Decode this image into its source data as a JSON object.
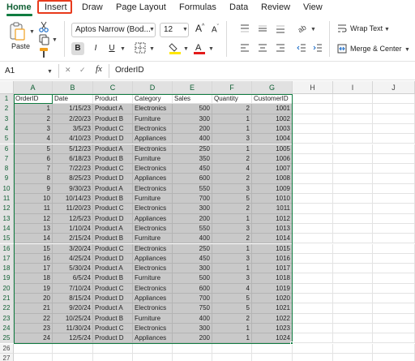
{
  "ribbon": {
    "tabs": [
      {
        "label": "Home",
        "active": true
      },
      {
        "label": "Insert",
        "highlighted": true
      },
      {
        "label": "Draw"
      },
      {
        "label": "Page Layout"
      },
      {
        "label": "Formulas"
      },
      {
        "label": "Data"
      },
      {
        "label": "Review"
      },
      {
        "label": "View"
      }
    ]
  },
  "toolbar": {
    "paste_label": "Paste",
    "font_name": "Aptos Narrow (Bod...",
    "font_size": "12",
    "bold": "B",
    "italic": "I",
    "underline": "U",
    "wrap_text_label": "Wrap Text",
    "merge_center_label": "Merge & Center",
    "highlight_color": "#ffe600",
    "font_color": "#e31b1b",
    "accent": "#107c41",
    "highlight_box": "#e83a1c"
  },
  "formula_bar": {
    "name_box": "A1",
    "fx_symbol": "fx",
    "value": "OrderID"
  },
  "sheet": {
    "columns": [
      "A",
      "B",
      "C",
      "D",
      "E",
      "F",
      "G",
      "H",
      "I",
      "J"
    ],
    "headers": [
      "OrderID",
      "Date",
      "Product",
      "Category",
      "Sales",
      "Quantity",
      "CustomerID"
    ],
    "rows": [
      [
        "1",
        "1/15/23",
        "Product A",
        "Electronics",
        "500",
        "2",
        "1001"
      ],
      [
        "2",
        "2/20/23",
        "Product B",
        "Furniture",
        "300",
        "1",
        "1002"
      ],
      [
        "3",
        "3/5/23",
        "Product C",
        "Electronics",
        "200",
        "1",
        "1003"
      ],
      [
        "4",
        "4/10/23",
        "Product D",
        "Appliances",
        "400",
        "3",
        "1004"
      ],
      [
        "5",
        "5/12/23",
        "Product A",
        "Electronics",
        "250",
        "1",
        "1005"
      ],
      [
        "6",
        "6/18/23",
        "Product B",
        "Furniture",
        "350",
        "2",
        "1006"
      ],
      [
        "7",
        "7/22/23",
        "Product C",
        "Electronics",
        "450",
        "4",
        "1007"
      ],
      [
        "8",
        "8/25/23",
        "Product D",
        "Appliances",
        "600",
        "2",
        "1008"
      ],
      [
        "9",
        "9/30/23",
        "Product A",
        "Electronics",
        "550",
        "3",
        "1009"
      ],
      [
        "10",
        "10/14/23",
        "Product B",
        "Furniture",
        "700",
        "5",
        "1010"
      ],
      [
        "11",
        "11/20/23",
        "Product C",
        "Electronics",
        "300",
        "2",
        "1011"
      ],
      [
        "12",
        "12/5/23",
        "Product D",
        "Appliances",
        "200",
        "1",
        "1012"
      ],
      [
        "13",
        "1/10/24",
        "Product A",
        "Electronics",
        "550",
        "3",
        "1013"
      ],
      [
        "14",
        "2/15/24",
        "Product B",
        "Furniture",
        "400",
        "2",
        "1014"
      ],
      [
        "15",
        "3/20/24",
        "Product C",
        "Electronics",
        "250",
        "1",
        "1015"
      ],
      [
        "16",
        "4/25/24",
        "Product D",
        "Appliances",
        "450",
        "3",
        "1016"
      ],
      [
        "17",
        "5/30/24",
        "Product A",
        "Electronics",
        "300",
        "1",
        "1017"
      ],
      [
        "18",
        "6/5/24",
        "Product B",
        "Furniture",
        "500",
        "3",
        "1018"
      ],
      [
        "19",
        "7/10/24",
        "Product C",
        "Electronics",
        "600",
        "4",
        "1019"
      ],
      [
        "20",
        "8/15/24",
        "Product D",
        "Appliances",
        "700",
        "5",
        "1020"
      ],
      [
        "21",
        "9/20/24",
        "Product A",
        "Electronics",
        "750",
        "5",
        "1021"
      ],
      [
        "22",
        "10/25/24",
        "Product B",
        "Furniture",
        "400",
        "2",
        "1022"
      ],
      [
        "23",
        "11/30/24",
        "Product C",
        "Electronics",
        "300",
        "1",
        "1023"
      ],
      [
        "24",
        "12/5/24",
        "Product D",
        "Appliances",
        "200",
        "1",
        "1024"
      ]
    ],
    "row_numbers": [
      "1",
      "2",
      "3",
      "4",
      "5",
      "6",
      "7",
      "8",
      "9",
      "10",
      "11",
      "12",
      "13",
      "14",
      "15",
      "16",
      "17",
      "18",
      "19",
      "20",
      "21",
      "22",
      "23",
      "24",
      "25",
      "26",
      "27"
    ],
    "numeric_columns": [
      0,
      4,
      5,
      6
    ]
  }
}
